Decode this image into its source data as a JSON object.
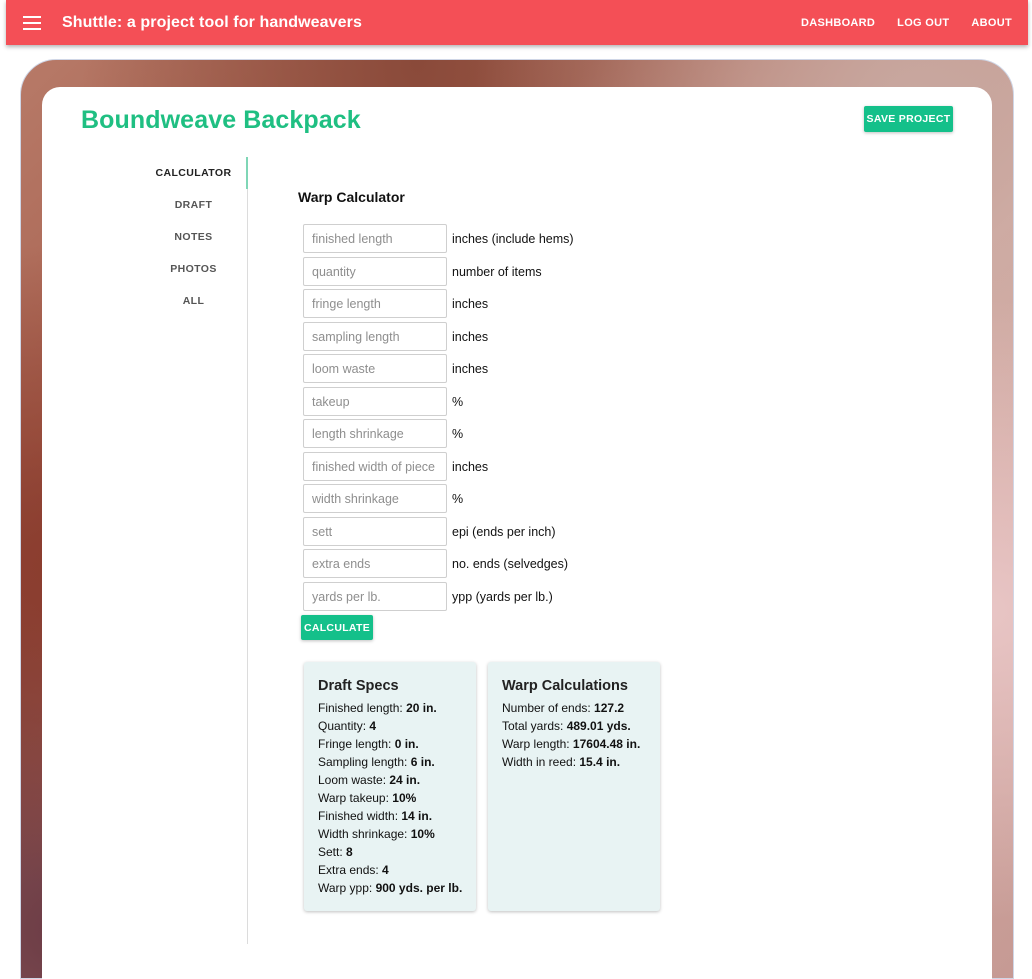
{
  "app": {
    "title": "Shuttle: a project tool for handweavers",
    "nav": [
      "DASHBOARD",
      "LOG OUT",
      "ABOUT"
    ],
    "bar_color": "#f44f56",
    "menu_icon": "hamburger-menu-icon"
  },
  "project": {
    "title": "Boundweave Backpack",
    "save_label": "SAVE PROJECT",
    "accent_color": "#1fbf82"
  },
  "sidebar": {
    "items": [
      {
        "label": "CALCULATOR",
        "active": true
      },
      {
        "label": "DRAFT"
      },
      {
        "label": "NOTES"
      },
      {
        "label": "PHOTOS"
      },
      {
        "label": "ALL"
      }
    ]
  },
  "calculator": {
    "title": "Warp Calculator",
    "fields": [
      {
        "placeholder": "finished length",
        "value": "",
        "unit": "inches (include hems)"
      },
      {
        "placeholder": "quantity",
        "value": "",
        "unit": "number of items"
      },
      {
        "placeholder": "fringe length",
        "value": "",
        "unit": "inches"
      },
      {
        "placeholder": "sampling length",
        "value": "",
        "unit": "inches"
      },
      {
        "placeholder": "loom waste",
        "value": "",
        "unit": "inches"
      },
      {
        "placeholder": "takeup",
        "value": "",
        "unit": "%"
      },
      {
        "placeholder": "length shrinkage",
        "value": "",
        "unit": "%"
      },
      {
        "placeholder": "finished width of piece",
        "value": "",
        "unit": "inches"
      },
      {
        "placeholder": "width shrinkage",
        "value": "",
        "unit": "%"
      },
      {
        "placeholder": "sett",
        "value": "",
        "unit": "epi (ends per inch)"
      },
      {
        "placeholder": "extra ends",
        "value": "",
        "unit": "no. ends (selvedges)"
      },
      {
        "placeholder": "yards per lb.",
        "value": "",
        "unit": "ypp (yards per lb.)"
      }
    ],
    "calculate_label": "CALCULATE"
  },
  "draft_specs": {
    "title": "Draft Specs",
    "lines": [
      {
        "label": "Finished length: ",
        "value": "20 in."
      },
      {
        "label": "Quantity: ",
        "value": "4"
      },
      {
        "label": "Fringe length: ",
        "value": "0 in."
      },
      {
        "label": "Sampling length: ",
        "value": "6 in."
      },
      {
        "label": "Loom waste: ",
        "value": "24 in."
      },
      {
        "label": "Warp takeup: ",
        "value": "10%"
      },
      {
        "label": "Finished width: ",
        "value": "14 in."
      },
      {
        "label": "Width shrinkage: ",
        "value": "10%"
      },
      {
        "label": "Sett: ",
        "value": "8"
      },
      {
        "label": "Extra ends: ",
        "value": "4"
      },
      {
        "label": "Warp ypp: ",
        "value": "900 yds. per lb."
      }
    ]
  },
  "warp_calculations": {
    "title": "Warp Calculations",
    "lines": [
      {
        "label": "Number of ends: ",
        "value": "127.2"
      },
      {
        "label": "Total yards: ",
        "value": "489.01 yds."
      },
      {
        "label": "Warp length: ",
        "value": "17604.48 in."
      },
      {
        "label": "Width in reed: ",
        "value": "15.4 in."
      }
    ]
  }
}
